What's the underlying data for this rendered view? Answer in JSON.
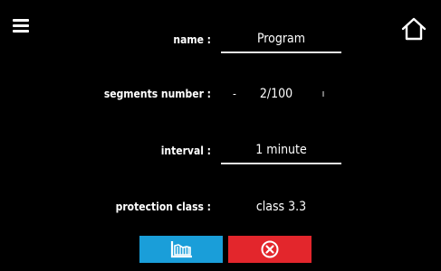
{
  "header": {
    "menu_icon": "hamburger-menu-icon",
    "home_icon": "home-icon"
  },
  "form": {
    "name_label": "name :",
    "name_value": "Program",
    "segments_label": "segments number :",
    "segments_minus": "-",
    "segments_value": "2/100",
    "segments_plus": "ı",
    "interval_label": "interval :",
    "interval_value": "1 minute",
    "protection_label": "protection class :",
    "protection_value": "class 3.3"
  },
  "actions": {
    "graph_icon": "program-graph-icon",
    "cancel_icon": "cancel-x-circle-icon"
  },
  "colors": {
    "background": "#000000",
    "graph_button": "#1a9ed9",
    "cancel_button": "#e3262c"
  }
}
